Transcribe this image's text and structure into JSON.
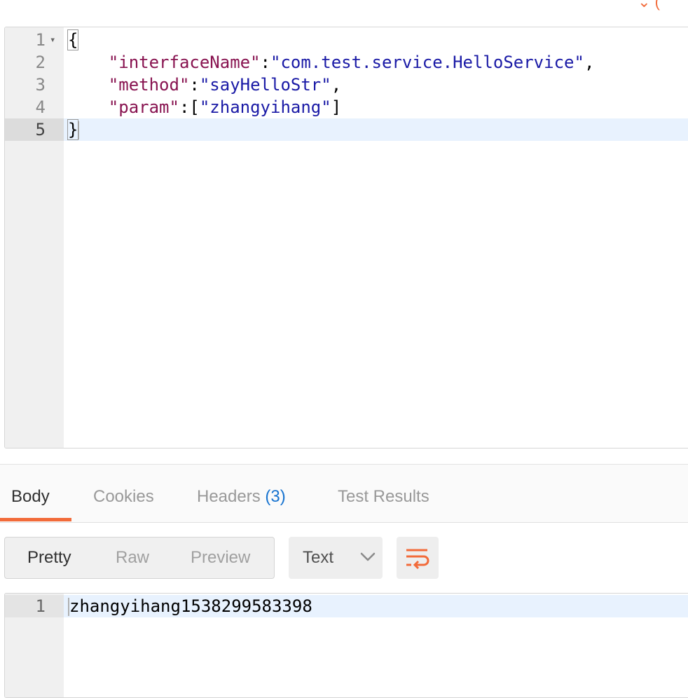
{
  "request_editor": {
    "lines": [
      {
        "num": "1",
        "parts": [
          {
            "cls": "bracket-hl",
            "text": "{"
          }
        ]
      },
      {
        "num": "2",
        "parts": [
          {
            "cls": "",
            "text": "    "
          },
          {
            "cls": "key",
            "text": "\"interfaceName\""
          },
          {
            "cls": "",
            "text": ":"
          },
          {
            "cls": "str",
            "text": "\"com.test.service.HelloService\""
          },
          {
            "cls": "",
            "text": ","
          }
        ]
      },
      {
        "num": "3",
        "parts": [
          {
            "cls": "",
            "text": "    "
          },
          {
            "cls": "key",
            "text": "\"method\""
          },
          {
            "cls": "",
            "text": ":"
          },
          {
            "cls": "str",
            "text": "\"sayHelloStr\""
          },
          {
            "cls": "",
            "text": ","
          }
        ]
      },
      {
        "num": "4",
        "parts": [
          {
            "cls": "",
            "text": "    "
          },
          {
            "cls": "key",
            "text": "\"param\""
          },
          {
            "cls": "",
            "text": ":["
          },
          {
            "cls": "str",
            "text": "\"zhangyihang\""
          },
          {
            "cls": "",
            "text": "]"
          }
        ]
      },
      {
        "num": "5",
        "parts": [
          {
            "cls": "bracket-hl",
            "text": "}"
          }
        ]
      }
    ],
    "active_line": 4
  },
  "response_tabs": {
    "body": "Body",
    "cookies": "Cookies",
    "headers": "Headers",
    "headers_count": "(3)",
    "test_results": "Test Results"
  },
  "view_modes": {
    "pretty": "Pretty",
    "raw": "Raw",
    "preview": "Preview"
  },
  "format_select": {
    "value": "Text"
  },
  "colors": {
    "accent": "#f26b3a",
    "link": "#1874d0"
  },
  "response": {
    "line_num": "1",
    "text": "zhangyihang1538299583398"
  }
}
